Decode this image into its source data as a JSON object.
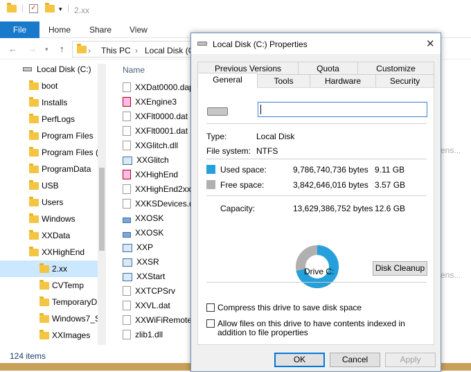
{
  "explorer": {
    "title": "2.xx",
    "ribbon": {
      "file": "File",
      "home": "Home",
      "share": "Share",
      "view": "View"
    },
    "address": [
      "This PC",
      "Local Disk (C"
    ],
    "address_sep": "›",
    "nav_items": [
      {
        "label": "Local Disk (C:)",
        "type": "drive"
      },
      {
        "label": "boot",
        "type": "folder"
      },
      {
        "label": "Installs",
        "type": "folder"
      },
      {
        "label": "PerfLogs",
        "type": "folder"
      },
      {
        "label": "Program Files",
        "type": "folder"
      },
      {
        "label": "Program Files (",
        "type": "folder"
      },
      {
        "label": "ProgramData",
        "type": "folder"
      },
      {
        "label": "USB",
        "type": "folder"
      },
      {
        "label": "Users",
        "type": "folder"
      },
      {
        "label": "Windows",
        "type": "folder"
      },
      {
        "label": "XXData",
        "type": "folder"
      },
      {
        "label": "XXHighEnd",
        "type": "folder"
      },
      {
        "label": "2.xx",
        "type": "folder",
        "selected": true
      },
      {
        "label": "CVTemp",
        "type": "folder"
      },
      {
        "label": "TemporaryD",
        "type": "folder"
      },
      {
        "label": "Windows7_S",
        "type": "folder"
      },
      {
        "label": "XXImages",
        "type": "folder"
      }
    ],
    "column_name": "Name",
    "files": [
      {
        "name": "XXDat0000.dap",
        "icon": "file"
      },
      {
        "name": "XXEngine3",
        "icon": "red"
      },
      {
        "name": "XXFlt0000.dat",
        "icon": "file"
      },
      {
        "name": "XXFlt0001.dat",
        "icon": "file"
      },
      {
        "name": "XXGlitch.dll",
        "icon": "file"
      },
      {
        "name": "XXGlitch",
        "icon": "app"
      },
      {
        "name": "XXHighEnd",
        "icon": "red"
      },
      {
        "name": "XXHighEnd2xx",
        "icon": "file"
      },
      {
        "name": "XXKSDevices.d",
        "icon": "file"
      },
      {
        "name": "XXOSK",
        "icon": "kbd"
      },
      {
        "name": "XXOSK",
        "icon": "kbd"
      },
      {
        "name": "XXP",
        "icon": "app"
      },
      {
        "name": "XXSR",
        "icon": "app"
      },
      {
        "name": "XXStart",
        "icon": "app"
      },
      {
        "name": "XXTCPSrv",
        "icon": "file"
      },
      {
        "name": "XXVL.dat",
        "icon": "file"
      },
      {
        "name": "XXWiFiRemote",
        "icon": "file"
      },
      {
        "name": "zlib1.dll",
        "icon": "file"
      }
    ],
    "ghost_text": "ens...",
    "status": "124 items"
  },
  "dialog": {
    "title": "Local Disk (C:) Properties",
    "close_glyph": "✕",
    "tabs_top": [
      "Previous Versions",
      "Quota",
      "Customize"
    ],
    "tabs_bottom": [
      "General",
      "Tools",
      "Hardware",
      "Security"
    ],
    "name_value": "",
    "type_label": "Type:",
    "type_value": "Local Disk",
    "fs_label": "File system:",
    "fs_value": "NTFS",
    "used_label": "Used space:",
    "used_bytes": "9,786,740,736 bytes",
    "used_gb": "9.11 GB",
    "free_label": "Free space:",
    "free_bytes": "3,842,646,016 bytes",
    "free_gb": "3.57 GB",
    "capacity_label": "Capacity:",
    "capacity_bytes": "13,629,386,752 bytes",
    "capacity_gb": "12.6 GB",
    "used_fraction": 0.718,
    "used_color": "#26a0da",
    "free_color": "#b0b0b0",
    "drive_label": "Drive C:",
    "cleanup": "Disk Cleanup",
    "compress": "Compress this drive to save disk space",
    "index": "Allow files on this drive to have contents indexed in addition to file properties",
    "ok": "OK",
    "cancel": "Cancel",
    "apply": "Apply"
  }
}
